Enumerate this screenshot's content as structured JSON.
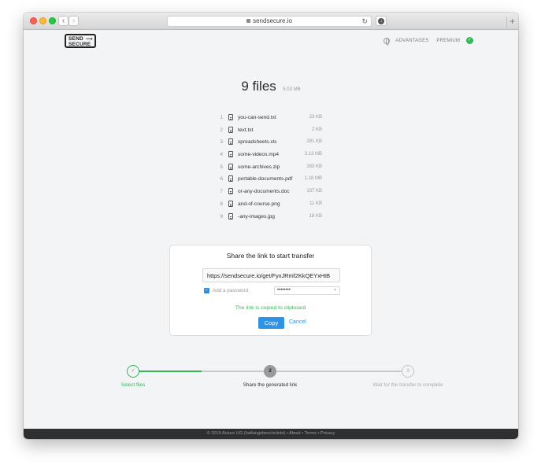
{
  "browser": {
    "url": "sendsecure.io"
  },
  "header": {
    "logo_line1": "SEND",
    "logo_line2": "SECURE",
    "nav_advantages": "ADVANTAGES",
    "nav_premium": "PREMIUM"
  },
  "files": {
    "count_label": "9 files",
    "total_size": "5.03 MB",
    "items": [
      {
        "num": "1",
        "name": "you-can-send.txt",
        "size": "23 KB"
      },
      {
        "num": "2",
        "name": "text.txt",
        "size": "2 KB"
      },
      {
        "num": "3",
        "name": "spreadsheets.xls",
        "size": "281 KB"
      },
      {
        "num": "4",
        "name": "some-videos.mp4",
        "size": "3.13 MB"
      },
      {
        "num": "5",
        "name": "some-archives.zip",
        "size": "283 KB"
      },
      {
        "num": "6",
        "name": "portable-documents.pdf",
        "size": "1.18 MB"
      },
      {
        "num": "7",
        "name": "or-any-documents.doc",
        "size": "137 KB"
      },
      {
        "num": "8",
        "name": "and-of-course.png",
        "size": "11 KB"
      },
      {
        "num": "9",
        "name": "-any-images.jpg",
        "size": "18 KB"
      }
    ]
  },
  "share": {
    "title": "Share the link to start transfer",
    "link_value": "https://sendsecure.io/get/FyxJRmf2KkQEYxHtB",
    "password_checked": true,
    "password_label": "Add a password",
    "password_value": "••••••••",
    "copied_message": "The link is copied to clipboard",
    "copy_label": "Copy",
    "cancel_label": "Cancel"
  },
  "steps": {
    "items": [
      {
        "num": "✓",
        "label": "Select files",
        "state": "done"
      },
      {
        "num": "2",
        "label": "Share the generated link",
        "state": "current"
      },
      {
        "num": "3",
        "label": "Wait for the transfer to complete",
        "state": "pending"
      }
    ]
  },
  "footer": {
    "text": "© 2019 Acture UG (haftungsbeschränkt) • About • Terms • Privacy"
  },
  "colors": {
    "accent_blue": "#2c93e6",
    "success_green": "#35b65a",
    "footer_bg": "#2d2f33",
    "page_bg": "#f3f4f6"
  }
}
